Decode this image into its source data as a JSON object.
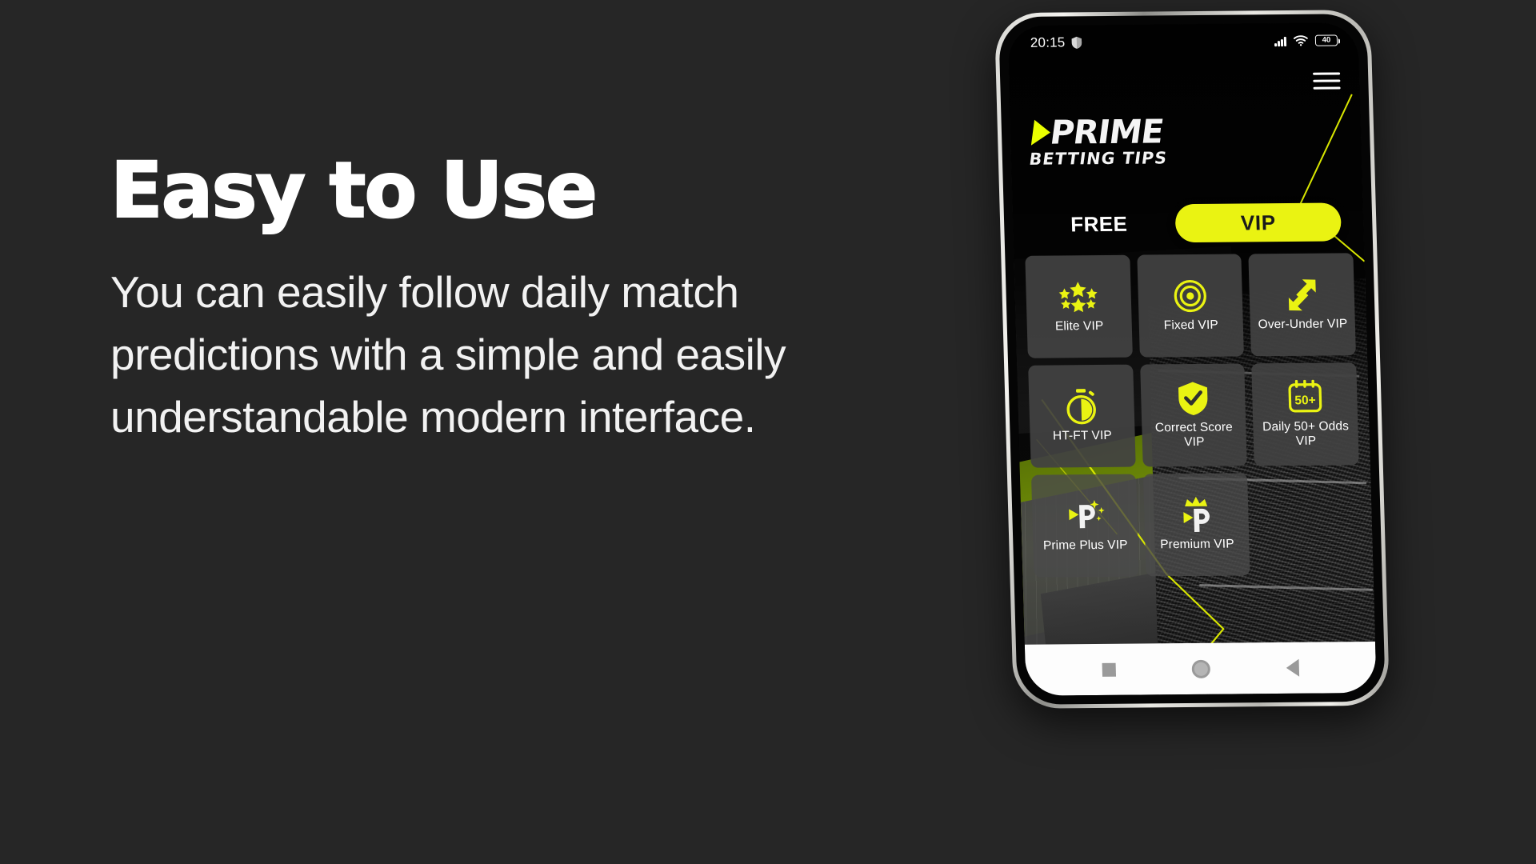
{
  "page": {
    "background_color": "#262626",
    "accent_color": "#eaf312"
  },
  "copy": {
    "headline": "Easy to Use",
    "body": "You can easily follow daily match predictions with a simple and easily understandable modern interface."
  },
  "phone": {
    "status_bar": {
      "time": "20:15",
      "left_icon": "shield-icon",
      "signal_icon": "signal-bars-icon",
      "wifi_icon": "wifi-icon",
      "battery_level": "40",
      "battery_icon": "battery-icon"
    },
    "menu_button": {
      "icon": "hamburger-menu-icon",
      "label": "Menu"
    },
    "brand": {
      "mark": "play-triangle-icon",
      "name": "PRIME",
      "tagline": "BETTING TIPS"
    },
    "tabs": [
      {
        "label": "FREE",
        "active": false
      },
      {
        "label": "VIP",
        "active": true
      }
    ],
    "tiles": [
      {
        "label": "Elite VIP",
        "icon": "stars-circle-icon"
      },
      {
        "label": "Fixed VIP",
        "icon": "bullseye-target-icon"
      },
      {
        "label": "Over-Under VIP",
        "icon": "up-down-arrows-icon"
      },
      {
        "label": "HT-FT VIP",
        "icon": "stopwatch-icon"
      },
      {
        "label": "Correct Score VIP",
        "icon": "shield-check-icon"
      },
      {
        "label": "Daily 50+ Odds VIP",
        "icon": "calendar-50plus-icon",
        "badge": "50+"
      },
      {
        "label": "Prime Plus VIP",
        "icon": "prime-sparkle-icon"
      },
      {
        "label": "Premium VIP",
        "icon": "prime-crown-icon"
      }
    ],
    "navigation_bar": [
      {
        "label": "Recents",
        "icon": "square-recents-icon"
      },
      {
        "label": "Home",
        "icon": "circle-home-icon"
      },
      {
        "label": "Back",
        "icon": "triangle-back-icon"
      }
    ]
  }
}
